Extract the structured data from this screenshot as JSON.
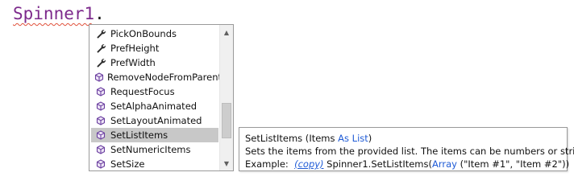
{
  "editor": {
    "identifier": "Spinner1",
    "dot": "."
  },
  "autocomplete": {
    "items": [
      {
        "label": "PickOnBounds",
        "icon": "wrench-icon",
        "kind": "property"
      },
      {
        "label": "PrefHeight",
        "icon": "wrench-icon",
        "kind": "property"
      },
      {
        "label": "PrefWidth",
        "icon": "wrench-icon",
        "kind": "property"
      },
      {
        "label": "RemoveNodeFromParent",
        "icon": "method-cube-icon",
        "kind": "method"
      },
      {
        "label": "RequestFocus",
        "icon": "method-cube-icon",
        "kind": "method"
      },
      {
        "label": "SetAlphaAnimated",
        "icon": "method-cube-icon",
        "kind": "method"
      },
      {
        "label": "SetLayoutAnimated",
        "icon": "method-cube-icon",
        "kind": "method"
      },
      {
        "label": "SetListItems",
        "icon": "method-cube-icon",
        "kind": "method",
        "selected": true
      },
      {
        "label": "SetNumericItems",
        "icon": "method-cube-icon",
        "kind": "method"
      },
      {
        "label": "SetSize",
        "icon": "method-cube-icon",
        "kind": "method"
      }
    ],
    "scroll_position": 0.78,
    "scroll_visible_fraction": 0.3
  },
  "tooltip": {
    "signature_name": "SetListItems",
    "signature_open": " (",
    "param_name": "Items",
    "param_as": "As",
    "param_type": "List",
    "signature_close": ")",
    "description": "Sets the items from the provided list. The items can be numbers or strings.",
    "example_label": "Example:",
    "copy_label": "(copy)",
    "example_code_prefix": " Spinner1.SetListItems(",
    "example_array": "Array",
    "example_args": " (\"Item #1\", \"Item #2\"))"
  },
  "colors": {
    "identifier": "#7d2a8c",
    "keyword": "#1f5bd6",
    "selection": "#c8c8c8",
    "squiggle": "#e0503a"
  }
}
